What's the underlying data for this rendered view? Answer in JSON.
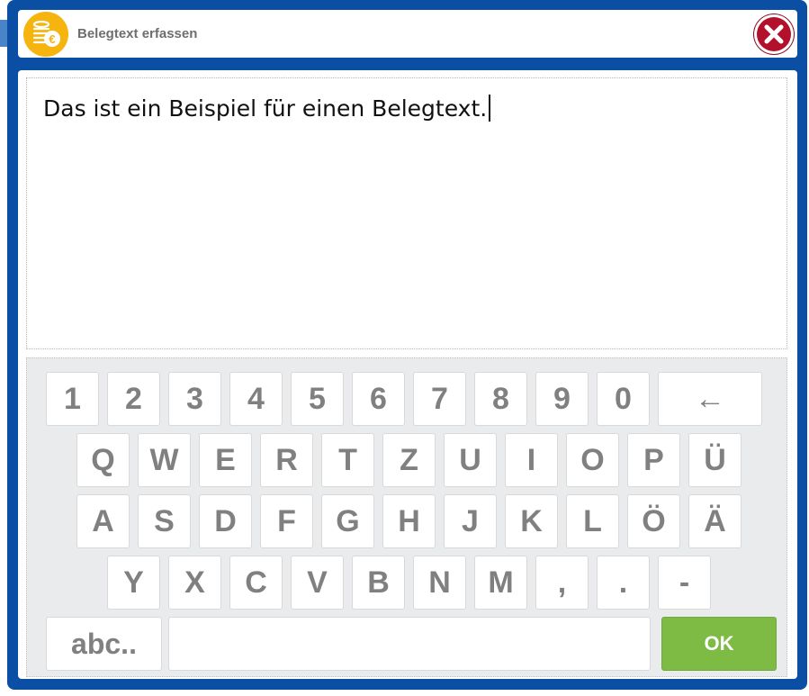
{
  "dialog": {
    "title": "Belegtext erfassen",
    "icon": "coins-euro-icon",
    "close_icon": "close-icon"
  },
  "textarea": {
    "value": "Das ist ein Beispiel für einen Belegtext."
  },
  "keyboard": {
    "row1": [
      "1",
      "2",
      "3",
      "4",
      "5",
      "6",
      "7",
      "8",
      "9",
      "0"
    ],
    "backspace": "←",
    "row2": [
      "Q",
      "W",
      "E",
      "R",
      "T",
      "Z",
      "U",
      "I",
      "O",
      "P",
      "Ü"
    ],
    "row3": [
      "A",
      "S",
      "D",
      "F",
      "G",
      "H",
      "J",
      "K",
      "L",
      "Ö",
      "Ä"
    ],
    "row4": [
      "Y",
      "X",
      "C",
      "V",
      "B",
      "N",
      "M",
      ",",
      ".",
      "-"
    ],
    "mode_label": "abc..",
    "space_label": "",
    "ok_label": "OK"
  },
  "colors": {
    "frame": "#0a4fa3",
    "ok": "#7dbb44",
    "close": "#b3102c",
    "icon": "#f5b40e"
  }
}
